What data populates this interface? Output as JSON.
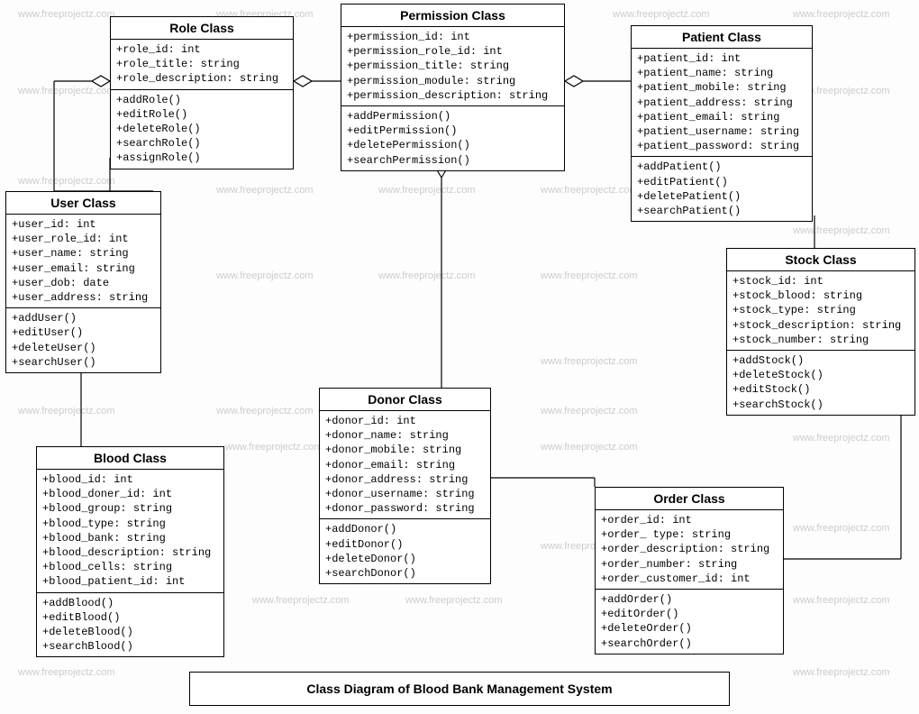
{
  "title": "Class Diagram of Blood Bank Management System",
  "watermark_text": "www.freeprojectz.com",
  "classes": {
    "role": {
      "name": "Role Class",
      "attrs": [
        "+role_id: int",
        "+role_title: string",
        "+role_description: string"
      ],
      "ops": [
        "+addRole()",
        "+editRole()",
        "+deleteRole()",
        "+searchRole()",
        "+assignRole()"
      ]
    },
    "permission": {
      "name": "Permission Class",
      "attrs": [
        "+permission_id: int",
        "+permission_role_id: int",
        "+permission_title: string",
        "+permission_module: string",
        "+permission_description: string"
      ],
      "ops": [
        "+addPermission()",
        "+editPermission()",
        "+deletePermission()",
        "+searchPermission()"
      ]
    },
    "patient": {
      "name": "Patient Class",
      "attrs": [
        "+patient_id: int",
        "+patient_name: string",
        "+patient_mobile: string",
        "+patient_address: string",
        "+patient_email: string",
        "+patient_username: string",
        "+patient_password: string"
      ],
      "ops": [
        "+addPatient()",
        "+editPatient()",
        "+deletePatient()",
        "+searchPatient()"
      ]
    },
    "user": {
      "name": "User Class",
      "attrs": [
        "+user_id: int",
        "+user_role_id: int",
        "+user_name: string",
        "+user_email: string",
        "+user_dob: date",
        "+user_address: string"
      ],
      "ops": [
        "+addUser()",
        "+editUser()",
        "+deleteUser()",
        "+searchUser()"
      ]
    },
    "stock": {
      "name": "Stock Class",
      "attrs": [
        "+stock_id: int",
        "+stock_blood: string",
        "+stock_type: string",
        "+stock_description: string",
        "+stock_number: string"
      ],
      "ops": [
        "+addStock()",
        "+deleteStock()",
        "+editStock()",
        "+searchStock()"
      ]
    },
    "donor": {
      "name": "Donor Class",
      "attrs": [
        "+donor_id: int",
        "+donor_name: string",
        "+donor_mobile: string",
        "+donor_email: string",
        "+donor_address: string",
        "+donor_username: string",
        "+donor_password: string"
      ],
      "ops": [
        "+addDonor()",
        "+editDonor()",
        "+deleteDonor()",
        "+searchDonor()"
      ]
    },
    "blood": {
      "name": "Blood Class",
      "attrs": [
        "+blood_id: int",
        "+blood_doner_id: int",
        "+blood_group: string",
        "+blood_type: string",
        "+blood_bank: string",
        "+blood_description: string",
        "+blood_cells: string",
        "+blood_patient_id: int"
      ],
      "ops": [
        "+addBlood()",
        "+editBlood()",
        "+deleteBlood()",
        "+searchBlood()"
      ]
    },
    "order": {
      "name": "Order Class",
      "attrs": [
        "+order_id: int",
        "+order_ type: string",
        "+order_description: string",
        "+order_number: string",
        "+order_customer_id: int"
      ],
      "ops": [
        "+addOrder()",
        "+editOrder()",
        "+deleteOrder()",
        "+searchOrder()"
      ]
    }
  }
}
